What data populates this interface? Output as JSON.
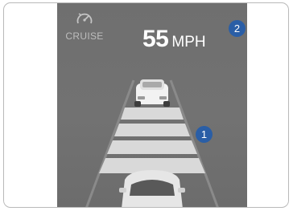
{
  "cruise": {
    "label": "CRUISE",
    "icon": "speedometer-icon"
  },
  "speed": {
    "value": "55",
    "unit": "MPH"
  },
  "callouts": {
    "one": "1",
    "two": "2"
  },
  "colors": {
    "display_bg": "#707070",
    "callout_blue": "#2a5ea6",
    "distance_bars": "#d9d9d9"
  }
}
